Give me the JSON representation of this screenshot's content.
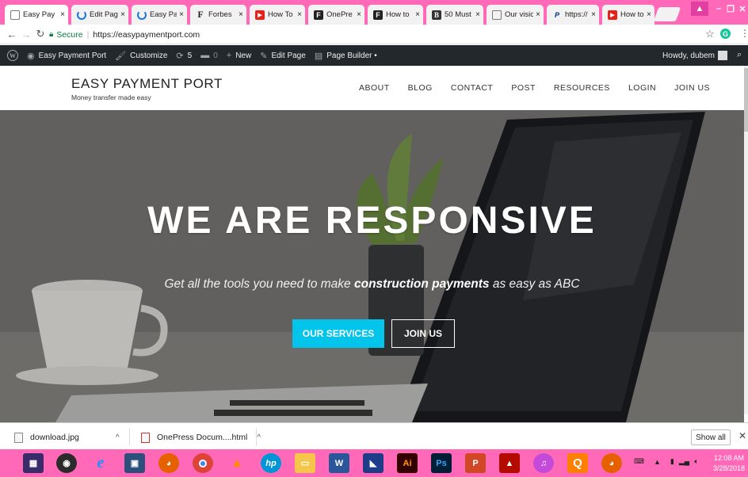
{
  "browser": {
    "tabs": [
      {
        "label": "Easy Pay",
        "icon": "page-icon"
      },
      {
        "label": "Edit Pag",
        "icon": "loading-icon"
      },
      {
        "label": "Easy Pay",
        "icon": "loading-icon"
      },
      {
        "label": "Forbes",
        "icon": "forbes-icon"
      },
      {
        "label": "How To",
        "icon": "youtube-icon"
      },
      {
        "label": "OnePre",
        "icon": "onepress-icon"
      },
      {
        "label": "How to",
        "icon": "onepress-icon"
      },
      {
        "label": "50 Must",
        "icon": "book-icon"
      },
      {
        "label": "Our visio",
        "icon": "page-icon"
      },
      {
        "label": "https://",
        "icon": "paypal-icon"
      },
      {
        "label": "How to",
        "icon": "youtube-icon"
      }
    ],
    "tab_close": "×",
    "secure_label": "Secure",
    "url": "https://easypaymentport.com"
  },
  "wp_admin_bar": {
    "items": [
      {
        "label": "Easy Payment Port",
        "icon": "dashboard-icon"
      },
      {
        "label": "Customize",
        "icon": "brush-icon"
      },
      {
        "label": "5",
        "icon": "updates-icon"
      },
      {
        "label": "0",
        "icon": "comment-icon"
      },
      {
        "label": "New",
        "icon": "plus-icon"
      },
      {
        "label": "Edit Page",
        "icon": "pencil-icon"
      },
      {
        "label": "Page Builder •",
        "icon": "builder-icon"
      }
    ],
    "howdy": "Howdy, dubem"
  },
  "site": {
    "title": "EASY PAYMENT PORT",
    "tagline": "Money transfer made easy",
    "nav": [
      "ABOUT",
      "BLOG",
      "CONTACT",
      "POST",
      "RESOURCES",
      "LOGIN",
      "JOIN US"
    ]
  },
  "hero": {
    "title": "WE ARE RESPONSIVE",
    "subtitle_pre": "Get all the tools you need to make ",
    "subtitle_bold": "construction payments",
    "subtitle_post": " as easy as ABC",
    "primary_button": "OUR SERVICES",
    "secondary_button": "JOIN US"
  },
  "downloads": {
    "items": [
      {
        "name": "download.jpg"
      },
      {
        "name": "OnePress Docum....html"
      }
    ],
    "show_all": "Show all"
  },
  "taskbar": {
    "apps": [
      "start",
      "media-player",
      "internet-explorer",
      "remote",
      "firefox",
      "chrome",
      "vlc",
      "hp",
      "file-explorer",
      "word",
      "generic",
      "illustrator",
      "photoshop",
      "powerpoint",
      "acrobat",
      "itunes",
      "qbittorrent",
      "firefox-2"
    ],
    "app_labels": {
      "word": "W",
      "illustrator": "Ai",
      "photoshop": "Ps",
      "powerpoint": "P",
      "qbittorrent": "Q",
      "hp": "hp"
    },
    "time": "12:08 AM",
    "date": "3/28/2018"
  },
  "colors": {
    "chrome_frame": "#ff69b8",
    "wp_bar": "#23282d",
    "accent": "#03c4eb"
  }
}
